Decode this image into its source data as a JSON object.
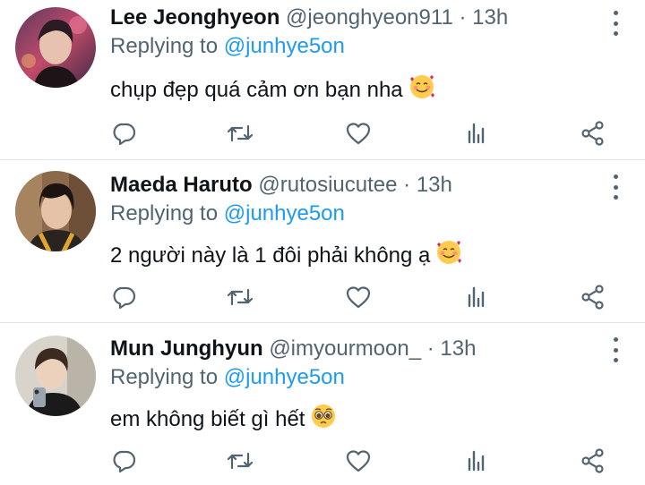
{
  "replies": [
    {
      "name": "Lee Jeonghyeon",
      "handle": "@jeonghyeon911",
      "separator": "·",
      "time": "13h",
      "replying_prefix": "Replying to",
      "replying_to": "@junhye5on",
      "text": "chụp đẹp quá cảm ơn bạn nha",
      "emoji": "smiling-face-with-hearts"
    },
    {
      "name": "Maeda Haruto",
      "handle": "@rutosiucutee",
      "separator": "·",
      "time": "13h",
      "replying_prefix": "Replying to",
      "replying_to": "@junhye5on",
      "text": "2 người này là 1 đôi phải không ạ",
      "emoji": "smiling-face-with-hearts"
    },
    {
      "name": "Mun Junghyun",
      "handle": "@imyourmoon_",
      "separator": "·",
      "time": "13h",
      "replying_prefix": "Replying to",
      "replying_to": "@junhye5on",
      "text": "em không biết gì hết",
      "emoji": "pleading-face"
    }
  ],
  "icons": {
    "reply": "reply-icon",
    "retweet": "retweet-icon",
    "like": "heart-icon",
    "analytics": "analytics-icon",
    "share": "share-icon",
    "more": "more-vertical-icon"
  },
  "colors": {
    "text": "#0f1419",
    "secondary": "#536471",
    "link": "#1d9bf0",
    "divider": "#e1e6ea"
  }
}
